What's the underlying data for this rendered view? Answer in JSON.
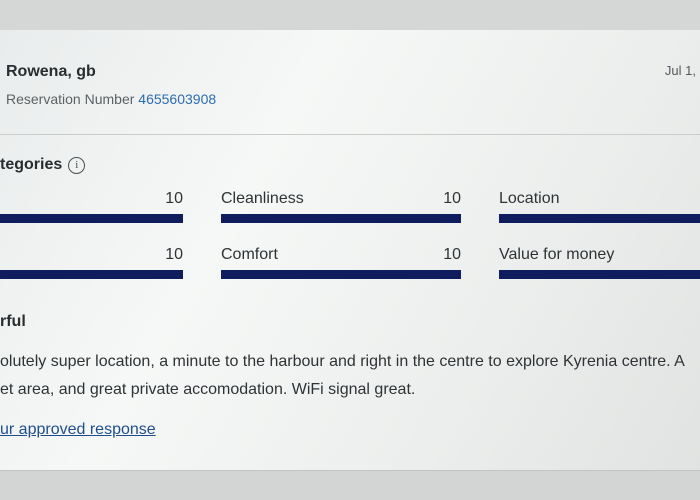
{
  "guest": {
    "name": "Rowena, gb",
    "reservation_label": "Reservation Number",
    "reservation_number": "4655603908",
    "date": "Jul 1,"
  },
  "categories": {
    "title": "tegories",
    "info_icon": "info-icon",
    "items": [
      {
        "label": "",
        "value": "10",
        "score": 10
      },
      {
        "label": "Cleanliness",
        "value": "10",
        "score": 10
      },
      {
        "label": "Location",
        "value": "",
        "score": 10
      },
      {
        "label": "",
        "value": "10",
        "score": 10
      },
      {
        "label": "Comfort",
        "value": "10",
        "score": 10
      },
      {
        "label": "Value for money",
        "value": "",
        "score": 10
      }
    ],
    "max_score": 10,
    "bar_color": "#0f1d5e"
  },
  "review": {
    "title": "rful",
    "lines": [
      "olutely super location, a minute to the harbour and right in the centre to explore Kyrenia centre. A",
      "et area, and great private accomodation. WiFi signal great."
    ],
    "response_link": "ur approved response"
  }
}
